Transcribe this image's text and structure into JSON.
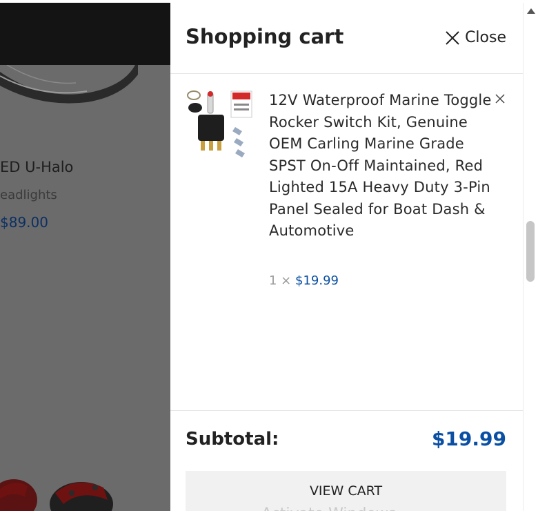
{
  "background": {
    "product_title": "ED U-Halo",
    "product_subtitle": "eadlights",
    "product_price": "$89.00"
  },
  "cart": {
    "title": "Shopping cart",
    "close_label": "Close",
    "items": [
      {
        "name": "12V Waterproof Marine Toggle Rocker Switch Kit, Genuine OEM Carling Marine Grade SPST On-Off Maintained, Red Lighted 15A Heavy Duty 3-Pin Panel Sealed for Boat Dash & Automotive",
        "quantity": "1 ×",
        "price": "$19.99"
      }
    ],
    "subtotal_label": "Subtotal:",
    "subtotal_value": "$19.99",
    "view_cart_label": "VIEW CART",
    "watermark": "Activate Windows"
  },
  "colors": {
    "accent_price": "#0a4fa3",
    "overlay": "#6b6b6b"
  },
  "icons": {
    "close": "close-x-icon",
    "remove": "remove-x-icon",
    "scroll_up": "triangle-up-icon"
  }
}
